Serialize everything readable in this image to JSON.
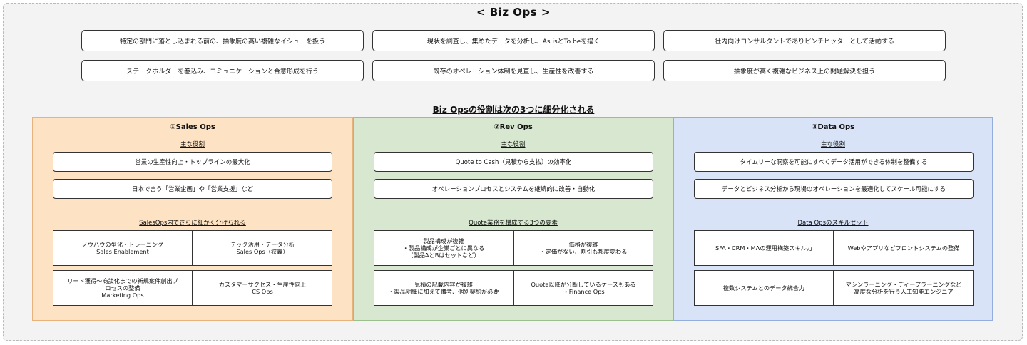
{
  "title": "< Biz Ops >",
  "top_boxes": [
    "特定の部門に落とし込まれる前の、抽象度の高い複雑なイシューを扱う",
    "現状を調査し、集めたデータを分析し、As isとTo beを描く",
    "社内向けコンサルタントでありピンチヒッターとして活動する",
    "ステークホルダーを巻込み、コミュニケーションと合意形成を行う",
    "既存のオペレーション体制を見直し、生産性を改善する",
    "抽象度が高く複雑なビジネス上の問題解決を担う"
  ],
  "subtitle": "Biz Opsの役割は次の3つに細分化される",
  "panels": {
    "sales": {
      "title": "①Sales Ops",
      "roles_label": "主な役割",
      "roles": [
        "営業の生産性向上・トップラインの最大化",
        "日本で言う「営業企画」や「営業支援」など"
      ],
      "grid_label": "SalesOps内でさらに細かく分けられる",
      "cells": [
        [
          "ノウハウの型化・トレーニング",
          "Sales Enablement"
        ],
        [
          "テック活用・データ分析",
          "Sales Ops（狭義）"
        ],
        [
          "リード獲得〜商談化までの新規案件創出プ",
          "ロセスの整備",
          "Marketing Ops"
        ],
        [
          "カスタマーサクセス・生産性向上",
          "CS Ops"
        ]
      ]
    },
    "rev": {
      "title": "②Rev Ops",
      "roles_label": "主な役割",
      "roles": [
        "Quote to Cash（見積から支払）の効率化",
        "オペレーションプロセスとシステムを継続的に改善・自動化"
      ],
      "grid_label": "Quote業務を構成する3つの要素",
      "cells": [
        [
          "製品構成が複雑",
          "・製品構成が企業ごとに異なる",
          "（製品AとBはセットなど）"
        ],
        [
          "価格が複雑",
          "・定価がない、割引も都度変わる"
        ],
        [
          "見積の記載内容が複雑",
          "・製品明細に加えて備考、個別契約が必要"
        ],
        [
          "Quote以降が分断しているケースもある",
          "→ Finance Ops"
        ]
      ]
    },
    "data": {
      "title": "③Data Ops",
      "roles_label": "主な役割",
      "roles": [
        "タイムリーな洞察を可能にすべくデータ活用ができる体制を整備する",
        "データとビジネス分析から現場のオペレーションを最適化してスケール可能にする"
      ],
      "grid_label": "Data Opsのスキルセット",
      "cells": [
        [
          "SFA・CRM・MAの運用構築スキル力"
        ],
        [
          "Webやアプリなどフロントシステムの整備"
        ],
        [
          "複数システムとのデータ統合力"
        ],
        [
          "マシンラーニング・ディープラーニングなど",
          "高度な分析を行う人工知能エンジニア"
        ]
      ]
    }
  }
}
